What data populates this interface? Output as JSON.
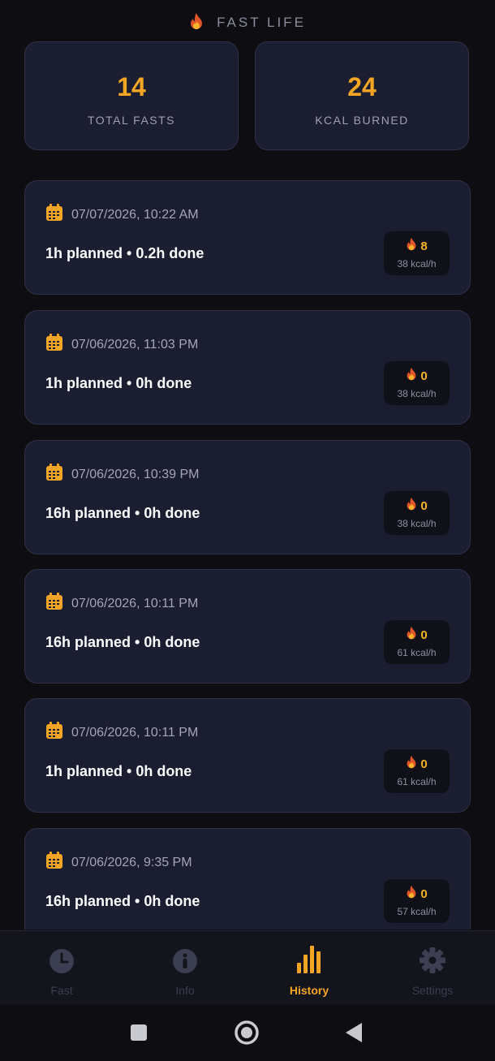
{
  "app": {
    "title": "FAST LIFE"
  },
  "stats": [
    {
      "value": "14",
      "label": "TOTAL FASTS"
    },
    {
      "value": "24",
      "label": "KCAL BURNED"
    }
  ],
  "history": [
    {
      "date": "07/07/2026, 10:22 AM",
      "summary": "1h planned • 0.2h done",
      "kcal": "8",
      "rate": "38 kcal/h"
    },
    {
      "date": "07/06/2026, 11:03 PM",
      "summary": "1h planned • 0h done",
      "kcal": "0",
      "rate": "38 kcal/h"
    },
    {
      "date": "07/06/2026, 10:39 PM",
      "summary": "16h planned • 0h done",
      "kcal": "0",
      "rate": "38 kcal/h"
    },
    {
      "date": "07/06/2026, 10:11 PM",
      "summary": "16h planned • 0h done",
      "kcal": "0",
      "rate": "61 kcal/h"
    },
    {
      "date": "07/06/2026, 10:11 PM",
      "summary": "1h planned • 0h done",
      "kcal": "0",
      "rate": "61 kcal/h"
    },
    {
      "date": "07/06/2026, 9:35 PM",
      "summary": "16h planned • 0h done",
      "kcal": "0",
      "rate": "57 kcal/h"
    }
  ],
  "tabs": [
    {
      "label": "Fast",
      "icon": "clock-icon",
      "active": false
    },
    {
      "label": "Info",
      "icon": "info-icon",
      "active": false
    },
    {
      "label": "History",
      "icon": "bar-chart-icon",
      "active": true
    },
    {
      "label": "Settings",
      "icon": "gear-icon",
      "active": false
    }
  ],
  "colors": {
    "accent": "#f5a524",
    "card": "#1b1d31",
    "background": "#0e0e12",
    "inactive": "#3c3e52"
  }
}
